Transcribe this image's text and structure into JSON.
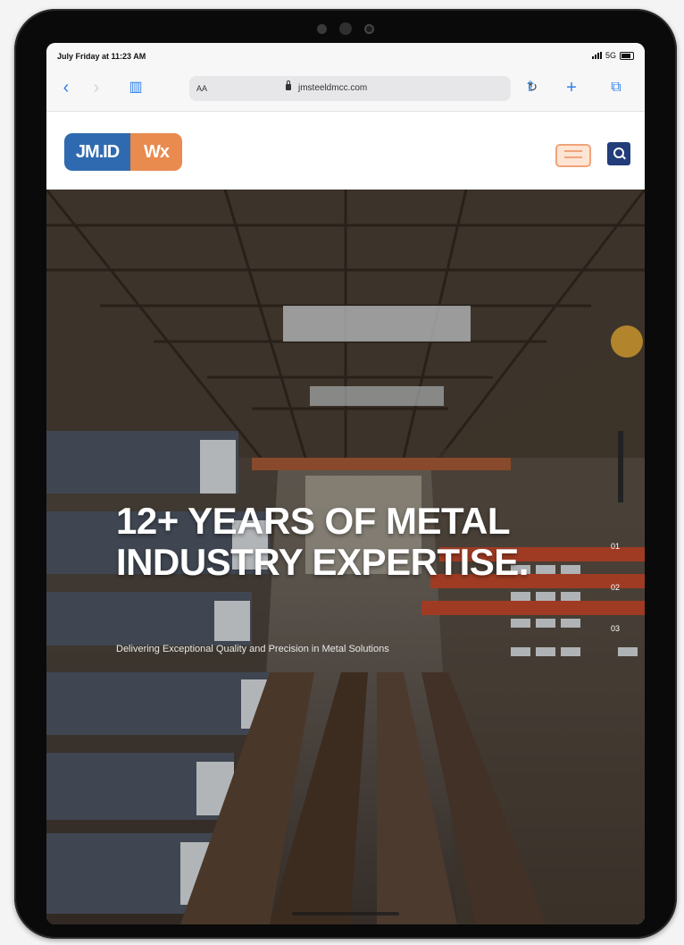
{
  "status": {
    "time": "July Friday at 11:23 AM",
    "network": "5G"
  },
  "browser": {
    "text_size": "AA",
    "url": "jmsteeldmcc.com"
  },
  "site": {
    "logo_left": "JM.ID",
    "logo_right": "Wx",
    "brand_colors": {
      "blue": "#2f6ab1",
      "orange": "#e98a4e",
      "navy": "#233c7a"
    }
  },
  "hero": {
    "title": "12+ YEARS OF METAL INDUSTRY EXPERTISE.",
    "subtitle": "Delivering Exceptional Quality and Precision in Metal Solutions",
    "slides": [
      "01",
      "02",
      "03"
    ]
  },
  "icons": [
    "back-icon",
    "forward-icon",
    "bookmarks-icon",
    "lock-icon",
    "reload-icon",
    "share-icon",
    "new-tab-icon",
    "tabs-icon",
    "menu-icon",
    "search-icon"
  ]
}
